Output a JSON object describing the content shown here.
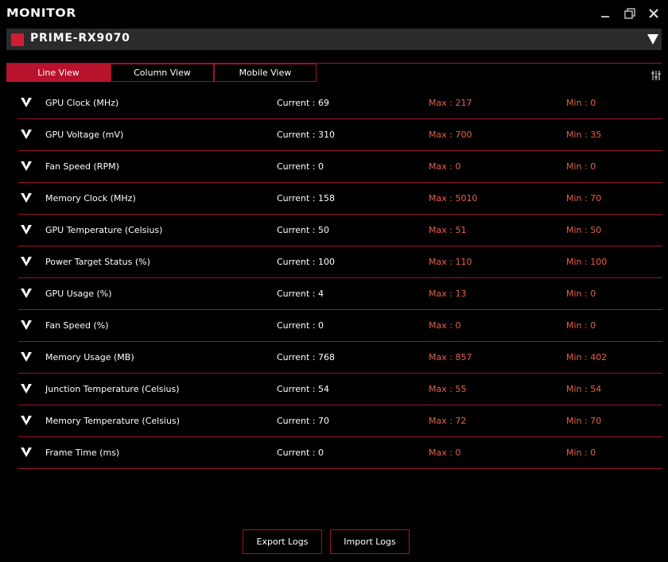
{
  "window": {
    "title": "MONITOR",
    "controls": [
      "minimize-icon",
      "restore-icon",
      "close-icon"
    ]
  },
  "device": {
    "name": "PRIME-RX9070",
    "swatch_color": "#d01c36"
  },
  "tabs": [
    {
      "label": "Line View",
      "active": true
    },
    {
      "label": "Column View",
      "active": false
    },
    {
      "label": "Mobile View",
      "active": false
    }
  ],
  "metrics": [
    {
      "name": "GPU Clock (MHz)",
      "current": "Current : 69",
      "max": "Max : 217",
      "min": "Min : 0"
    },
    {
      "name": "GPU Voltage (mV)",
      "current": "Current : 310",
      "max": "Max : 700",
      "min": "Min : 35"
    },
    {
      "name": "Fan Speed (RPM)",
      "current": "Current : 0",
      "max": "Max : 0",
      "min": "Min : 0"
    },
    {
      "name": "Memory Clock (MHz)",
      "current": "Current : 158",
      "max": "Max : 5010",
      "min": "Min : 70"
    },
    {
      "name": "GPU Temperature (Celsius)",
      "current": "Current : 50",
      "max": "Max : 51",
      "min": "Min : 50"
    },
    {
      "name": "Power Target Status (%)",
      "current": "Current : 100",
      "max": "Max : 110",
      "min": "Min : 100"
    },
    {
      "name": "GPU Usage (%)",
      "current": "Current : 4",
      "max": "Max : 13",
      "min": "Min : 0"
    },
    {
      "name": "Fan Speed (%)",
      "current": "Current : 0",
      "max": "Max : 0",
      "min": "Min : 0"
    },
    {
      "name": "Memory Usage (MB)",
      "current": "Current : 768",
      "max": "Max : 857",
      "min": "Min : 402"
    },
    {
      "name": "Junction Temperature (Celsius)",
      "current": "Current : 54",
      "max": "Max : 55",
      "min": "Min : 54"
    },
    {
      "name": "Memory Temperature (Celsius)",
      "current": "Current : 70",
      "max": "Max : 72",
      "min": "Min : 70"
    },
    {
      "name": "Frame Time (ms)",
      "current": "Current : 0",
      "max": "Max : 0",
      "min": "Min : 0"
    }
  ],
  "buttons": {
    "export": "Export Logs",
    "import": "Import Logs"
  },
  "colors": {
    "accent": "#b8122c",
    "divider": "#a0122a",
    "minmax_text": "#e8604a",
    "background": "#000000"
  }
}
